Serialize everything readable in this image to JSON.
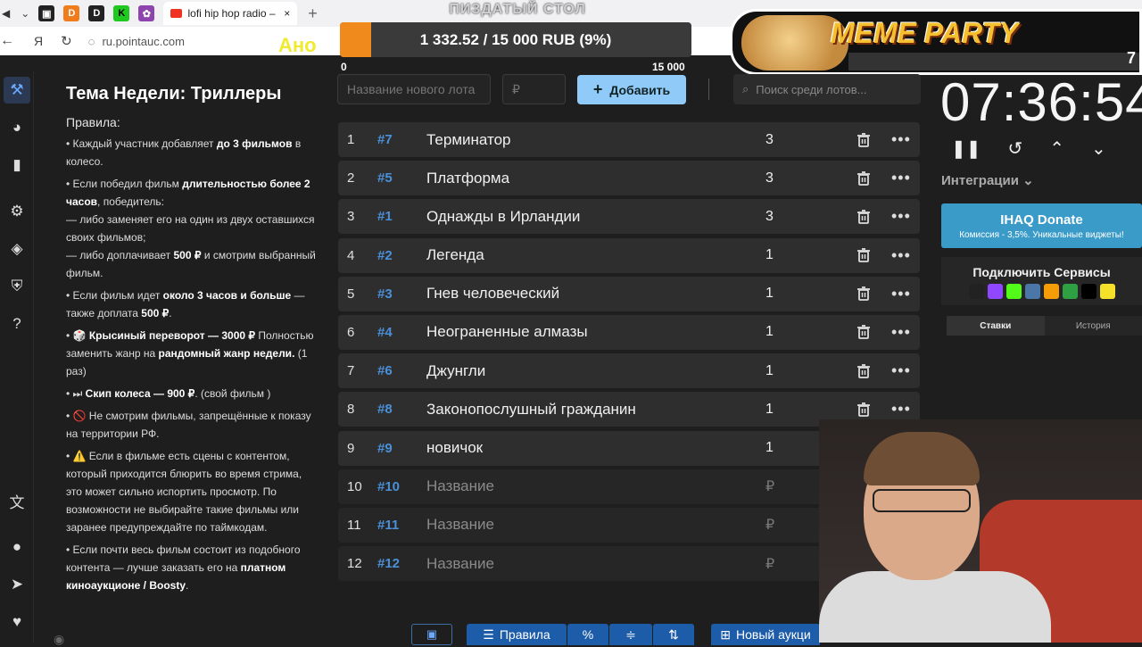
{
  "browser": {
    "active_tab_title": "lofi hip hop radio – b",
    "url": "ru.pointauc.com"
  },
  "stream": {
    "title": "ПИЗДАТЫЙ СТОЛ",
    "meme_label": "MEME PARTY",
    "ano": "Ано",
    "meme_number": "7"
  },
  "progress": {
    "text": "1 332.52 / 15 000 RUB (9%)",
    "fraction": 0.09,
    "min_label": "0",
    "max_label": "15 000"
  },
  "rules": {
    "title": "Тема Недели: Триллеры",
    "label": "Правила:"
  },
  "controls": {
    "lot_name_placeholder": "Название нового лота",
    "amount_placeholder": "₽",
    "add_label": "Добавить",
    "search_placeholder": "Поиск среди лотов..."
  },
  "lots": [
    {
      "num": "1",
      "id": "#7",
      "title": "Терминатор",
      "amount": "3",
      "empty": false
    },
    {
      "num": "2",
      "id": "#5",
      "title": "Платформа",
      "amount": "3",
      "empty": false
    },
    {
      "num": "3",
      "id": "#1",
      "title": "Однажды в Ирландии",
      "amount": "3",
      "empty": false
    },
    {
      "num": "4",
      "id": "#2",
      "title": "Легенда",
      "amount": "1",
      "empty": false
    },
    {
      "num": "5",
      "id": "#3",
      "title": "Гнев человеческий",
      "amount": "1",
      "empty": false
    },
    {
      "num": "6",
      "id": "#4",
      "title": "Неограненные алмазы",
      "amount": "1",
      "empty": false
    },
    {
      "num": "7",
      "id": "#6",
      "title": "Джунгли",
      "amount": "1",
      "empty": false
    },
    {
      "num": "8",
      "id": "#8",
      "title": "Законопослушный гражданин",
      "amount": "1",
      "empty": false
    },
    {
      "num": "9",
      "id": "#9",
      "title": "новичок",
      "amount": "1",
      "empty": false
    },
    {
      "num": "10",
      "id": "#10",
      "title": "Название",
      "amount": "₽",
      "empty": true
    },
    {
      "num": "11",
      "id": "#11",
      "title": "Название",
      "amount": "₽",
      "empty": true
    },
    {
      "num": "12",
      "id": "#12",
      "title": "Название",
      "amount": "₽",
      "empty": true
    }
  ],
  "timer": {
    "value": "07:36:54"
  },
  "right_panel": {
    "integrations_label": "Интеграции",
    "donate_title": "IHAQ Donate",
    "donate_sub": "Комиссия - 3,5%. Уникальные виджеты!",
    "services_title": "Подключить Сервисы",
    "tab_bids": "Ставки",
    "tab_history": "История"
  },
  "bottom": {
    "rules_label": "Правила",
    "new_auction_label": "Новый аукци"
  },
  "colors": {
    "accent": "#90caf9",
    "id_blue": "#4a90d9",
    "progress_fill": "#f08a1c",
    "donate": "#3a9bc8"
  }
}
